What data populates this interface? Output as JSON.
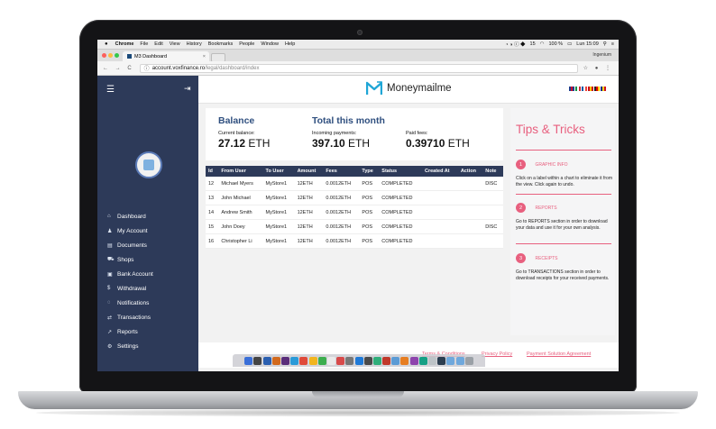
{
  "mac_menu": {
    "apple": "",
    "items": [
      "Chrome",
      "File",
      "Edit",
      "View",
      "History",
      "Bookmarks",
      "People",
      "Window",
      "Help"
    ],
    "battery": "100 %",
    "clock": "Lun 15:09",
    "wifi_count": "15"
  },
  "browser": {
    "tab_title": "M3 Dashboard",
    "tab_close": "×",
    "profile": "Ingenium",
    "nav": "← → C",
    "url_host": "account.voxfinance.ro",
    "url_path": "/legal/dashboard/index",
    "tools": "☆ ● ⋮"
  },
  "sidebar": {
    "menu_icon": "☰",
    "logout_icon": "⇥",
    "items": [
      {
        "icon": "⌂",
        "label": "Dashboard"
      },
      {
        "icon": "♟",
        "label": "My Account"
      },
      {
        "icon": "▤",
        "label": "Documents"
      },
      {
        "icon": "⛟",
        "label": "Shops"
      },
      {
        "icon": "▣",
        "label": "Bank Account"
      },
      {
        "icon": "$",
        "label": "Withdrawal"
      },
      {
        "icon": "◌",
        "label": "Notifications"
      },
      {
        "icon": "⇄",
        "label": "Transactions"
      },
      {
        "icon": "↗",
        "label": "Reports"
      },
      {
        "icon": "⚙",
        "label": "Settings"
      }
    ]
  },
  "header": {
    "brand": "Moneymailme",
    "brand_color": "#1fa6d6"
  },
  "balance": {
    "title": "Balance",
    "label": "Current balance:",
    "value": "27.12",
    "unit": "ETH"
  },
  "monthly": {
    "title": "Total this month",
    "incoming_label": "Incoming payments:",
    "incoming_value": "397.10",
    "paid_label": "Paid fees:",
    "paid_value": "0.39710",
    "unit": "ETH"
  },
  "table": {
    "headers": [
      "Id",
      "From User",
      "To User",
      "Amount",
      "Fees",
      "Type",
      "Status",
      "Created At",
      "Action",
      "Note"
    ],
    "rows": [
      [
        "12",
        "Michael Myers",
        "MyStore1",
        "12ETH",
        "0.0012ETH",
        "POS",
        "COMPLETED",
        "",
        "",
        "DISC"
      ],
      [
        "13",
        "John Michael",
        "MyStore1",
        "12ETH",
        "0.0012ETH",
        "POS",
        "COMPLETED",
        "",
        "",
        ""
      ],
      [
        "14",
        "Andrew Smith",
        "MyStore1",
        "12ETH",
        "0.0012ETH",
        "POS",
        "COMPLETED",
        "",
        "",
        ""
      ],
      [
        "15",
        "John Doey",
        "MyStore1",
        "12ETH",
        "0.0012ETH",
        "POS",
        "COMPLETED",
        "",
        "",
        "DISC"
      ],
      [
        "16",
        "Christopher Li",
        "MyStore1",
        "12ETH",
        "0.0012ETH",
        "POS",
        "COMPLETED",
        "",
        "",
        ""
      ]
    ]
  },
  "tips": {
    "title": "Tips & Tricks",
    "items": [
      {
        "num": "1",
        "label": "GRAPHIC INFO",
        "desc": "Click on a label within a chart to eliminate it from the view. Click again to undo."
      },
      {
        "num": "2",
        "label": "REPORTS",
        "desc": "Go to REPORTS section in order to download your data and use it for your own analysis."
      },
      {
        "num": "3",
        "label": "RECEIPTS",
        "desc": "Go to TRANSACTIONS section in order to download receipts for your received payments."
      }
    ]
  },
  "footer": {
    "links": [
      "Terms & Conditions",
      "Privacy Policy",
      "Payment Solution Agreement"
    ]
  },
  "colors": {
    "sidebar": "#2d3a59",
    "heading": "#2f4f7f",
    "accent": "#e8607f"
  }
}
